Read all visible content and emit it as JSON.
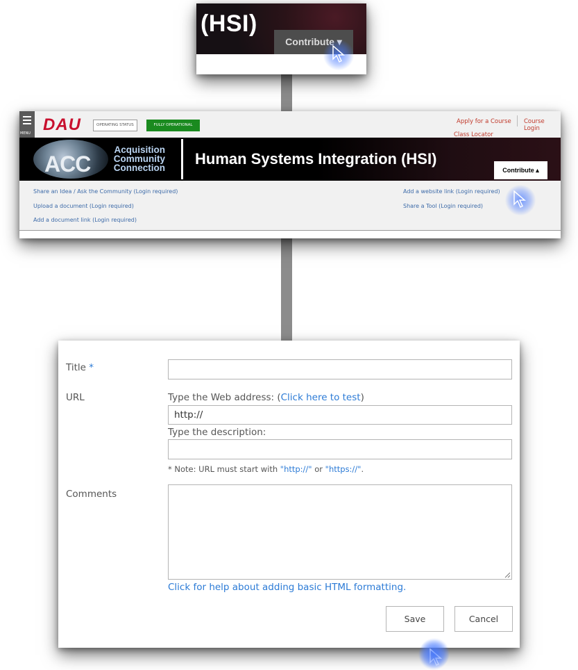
{
  "panel_zoom": {
    "title": "(HSI)",
    "contribute_button": "Contribute ▾"
  },
  "header": {
    "menu_label": "MENU",
    "logo": "DAU",
    "operating_status_label": "OPERATING STATUS",
    "operating_status_value": "FULLY OPERATIONAL",
    "links": {
      "apply": "Apply for a Course",
      "course_login": "Course Login",
      "class_locator": "Class Locator"
    }
  },
  "banner": {
    "logo_text": "ACC",
    "site_name_line1": "Acquisition",
    "site_name_line2": "Community",
    "site_name_line3": "Connection",
    "page_title": "Human Systems Integration (HSI)",
    "contribute_button": "Contribute ▴"
  },
  "contribute_menu": {
    "left": [
      "Share an Idea / Ask the Community (Login required)",
      "Upload a document (Login required)",
      "Add a document link (Login required)"
    ],
    "right": [
      "Add a website link (Login required)",
      "Share a Tool (Login required)"
    ]
  },
  "form": {
    "title_label": "Title",
    "required_mark": "*",
    "title_value": "",
    "url_label": "URL",
    "url_instructions": "Type the Web address: (",
    "url_test_link": "Click here to test",
    "url_instructions_end": ")",
    "url_value": "http://",
    "description_label": "Type the description:",
    "description_value": "",
    "note_prefix": "* Note: URL must start with ",
    "note_http": "\"http://\"",
    "note_or": " or ",
    "note_https": "\"https://\"",
    "note_end": ".",
    "comments_label": "Comments",
    "comments_value": "",
    "help_link": "Click for help about adding basic HTML formatting.",
    "save_button": "Save",
    "cancel_button": "Cancel"
  },
  "colors": {
    "link_blue": "#2c7bd6",
    "dau_red": "#c8102e",
    "status_green": "#1a8a1f",
    "cursor_highlight": "#4678ff"
  }
}
